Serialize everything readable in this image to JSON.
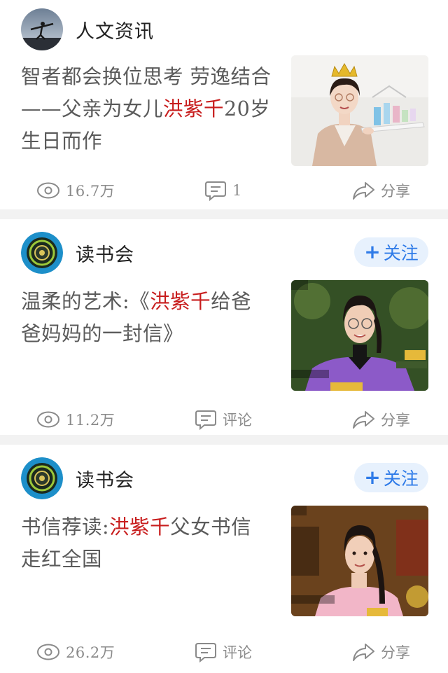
{
  "feed": {
    "cards": [
      {
        "author": "人文资讯",
        "title_parts": [
          "智者都会换位思考 劳逸结合——父亲为女儿",
          "洪紫千",
          "20岁生日而作"
        ],
        "views": "16.7万",
        "comments": "1",
        "share": "分享"
      },
      {
        "author": "读书会",
        "follow": "关注",
        "follow_icon": "+",
        "title_parts": [
          "温柔的艺术:《",
          "洪紫千",
          "给爸爸妈妈的一封信》"
        ],
        "views": "11.2万",
        "comments": "评论",
        "share": "分享"
      },
      {
        "author": "读书会",
        "follow": "关注",
        "follow_icon": "+",
        "title_parts": [
          "书信荐读:",
          "洪紫千",
          "父女书信走红全国"
        ],
        "views": "26.2万",
        "comments": "评论",
        "share": "分享"
      }
    ]
  },
  "colors": {
    "highlight": "#c81e1e",
    "follow_text": "#2f7be8",
    "follow_bg": "#e7f1fd",
    "meta": "#8a8a8a",
    "divider": "#f2f2f2"
  },
  "icons": {
    "views": "eye-icon",
    "comments": "comment-icon",
    "share": "share-icon"
  }
}
